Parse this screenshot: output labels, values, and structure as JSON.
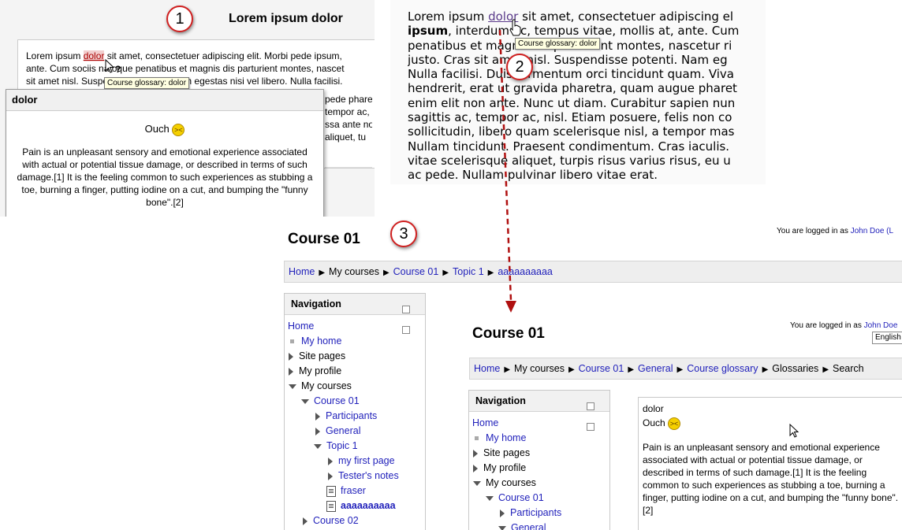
{
  "badges": {
    "one": "1",
    "two": "2",
    "three": "3"
  },
  "tooltip": "Course glossary: dolor",
  "panel1": {
    "title": "Lorem ipsum dolor",
    "lines": [
      {
        "pre": "Lorem ipsum ",
        "link": "dolor",
        "post": " sit amet, consectetuer adipiscing elit. Morbi pede ipsum, "
      },
      {
        "pre": "ante. Cum sociis natoque penatibus et magnis dis parturient montes, nascet",
        "link": "",
        "post": ""
      },
      {
        "pre": "sit amet nisl. Suspendisse potenti. Nam egestas nisi vel libero. Nulla facilisi.",
        "link": "",
        "post": ""
      }
    ],
    "right_lines": [
      "pede pharetr",
      "tempor ac, n",
      "ssa ante no",
      "aliquet, tu"
    ],
    "popup": {
      "title": "dolor",
      "ouch": "Ouch",
      "definition": "Pain is an unpleasant sensory and emotional experience associated with actual or potential tissue damage, or described in terms of such damage.[1] It is the feeling common to such experiences as stubbing a toe, burning a finger, putting iodine on a cut, and bumping the \"funny bone\".[2]"
    }
  },
  "panel2": {
    "line1": {
      "pre": "Lorem ipsum ",
      "link": "dolor",
      "post": " sit amet, consectetuer adipiscing el"
    },
    "line2": {
      "bold": "ipsum",
      "rest": ", interdum ac, tempus vitae, mollis at, ante. Cum"
    },
    "lines": [
      "penatibus et magnis dis parturient montes, nascetur ri",
      "justo. Cras sit amet nisl. Suspendisse potenti. Nam eg",
      "Nulla facilisi. Duis fermentum orci tincidunt quam. Viva",
      "hendrerit, erat ut gravida pharetra, quam augue pharet",
      "enim elit non ante. Nunc ut diam. Curabitur sapien nun",
      "sagittis ac, tempor ac, nisl. Etiam posuere, felis non co",
      "sollicitudin, libero quam scelerisque nisl, a tempor mas",
      "Nullam tincidunt. Praesent condimentum. Cras iaculis.",
      "vitae scelerisque aliquet, turpis risus varius risus, eu u",
      "ac pede. Nullam pulvinar libero vitae erat."
    ]
  },
  "panel3": {
    "title": "Course 01",
    "login_text": "You are logged in as ",
    "login_user": "John Doe (L",
    "breadcrumb": [
      "Home",
      "My courses",
      "Course 01",
      "Topic 1",
      "aaaaaaaaaa"
    ],
    "nav": {
      "title": "Navigation",
      "items": [
        "Home",
        "My home",
        "Site pages",
        "My profile",
        "My courses",
        "Course 01",
        "Participants",
        "General",
        "Topic 1",
        "my first page",
        "Tester's notes",
        "fraser",
        "aaaaaaaaaa",
        "Course 02"
      ]
    },
    "inner": {
      "title": "Course 01",
      "login_text": "You are logged in as ",
      "login_user": "John Doe",
      "language": "English",
      "breadcrumb": [
        "Home",
        "My courses",
        "Course 01",
        "General",
        "Course glossary",
        "Glossaries",
        "Search"
      ],
      "nav": {
        "title": "Navigation",
        "items": [
          "Home",
          "My home",
          "Site pages",
          "My profile",
          "My courses",
          "Course 01",
          "Participants",
          "General"
        ]
      },
      "entry": {
        "term": "dolor",
        "ouch": "Ouch",
        "definition": "Pain is an unpleasant sensory and emotional experience associated with actual or potential tissue damage, or described in terms of such damage.[1] It is the feeling common to such experiences as stubbing a toe, burning a finger, putting iodine on a cut, and bumping the \"funny bone\".[2]"
      }
    }
  },
  "colors": {
    "link": "#2222bb",
    "accent": "#cc1111",
    "highlight": "#f2cfcf"
  },
  "icons": [
    "smiley-icon",
    "help-cursor-icon",
    "hand-cursor-icon",
    "arrow-cursor-icon",
    "expand-icon",
    "collapse-icon",
    "page-icon",
    "dock-icon"
  ]
}
